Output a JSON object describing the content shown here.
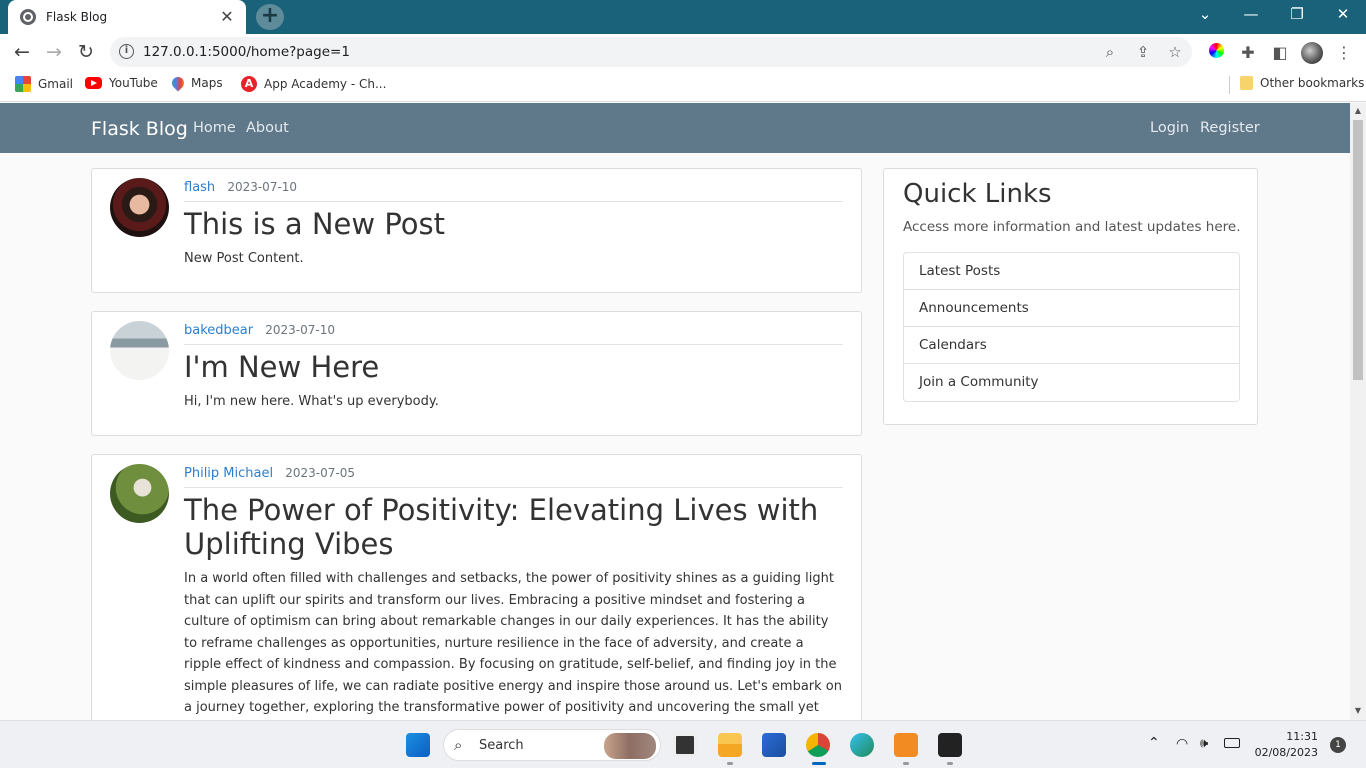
{
  "browser": {
    "tab_title": "Flask Blog",
    "url": "127.0.0.1:5000/home?page=1",
    "bookmarks": [
      {
        "label": "Gmail",
        "icon": "gmail-icon"
      },
      {
        "label": "YouTube",
        "icon": "youtube-icon"
      },
      {
        "label": "Maps",
        "icon": "maps-icon"
      },
      {
        "label": "App Academy - Ch...",
        "icon": "app-academy-icon"
      }
    ],
    "other_bookmarks": "Other bookmarks"
  },
  "site": {
    "brand": "Flask Blog",
    "nav_left": [
      "Home",
      "About"
    ],
    "nav_right": [
      "Login",
      "Register"
    ],
    "colors": {
      "navbar": "#5f788a",
      "link": "#2d7ecb"
    }
  },
  "posts": [
    {
      "author": "flash",
      "date": "2023-07-10",
      "title": "This is a New Post",
      "content": "New Post Content."
    },
    {
      "author": "bakedbear",
      "date": "2023-07-10",
      "title": "I'm New Here",
      "content": "Hi, I'm new here. What's up everybody."
    },
    {
      "author": "Philip Michael",
      "date": "2023-07-05",
      "title": "The Power of Positivity: Elevating Lives with Uplifting Vibes",
      "content": "In a world often filled with challenges and setbacks, the power of positivity shines as a guiding light that can uplift our spirits and transform our lives. Embracing a positive mindset and fostering a culture of optimism can bring about remarkable changes in our daily experiences. It has the ability to reframe challenges as opportunities, nurture resilience in the face of adversity, and create a ripple effect of kindness and compassion. By focusing on gratitude, self-belief, and finding joy in the simple pleasures of life, we can radiate positive energy and inspire those around us. Let's embark on a journey together, exploring the transformative power of positivity and uncovering the small yet profound ways we can"
    }
  ],
  "sidebar": {
    "title": "Quick Links",
    "subtitle": "Access more information and latest updates here.",
    "links": [
      "Latest Posts",
      "Announcements",
      "Calendars",
      "Join a Community"
    ]
  },
  "taskbar": {
    "search_label": "Search",
    "time": "11:31",
    "date": "02/08/2023",
    "notifications": "1"
  }
}
